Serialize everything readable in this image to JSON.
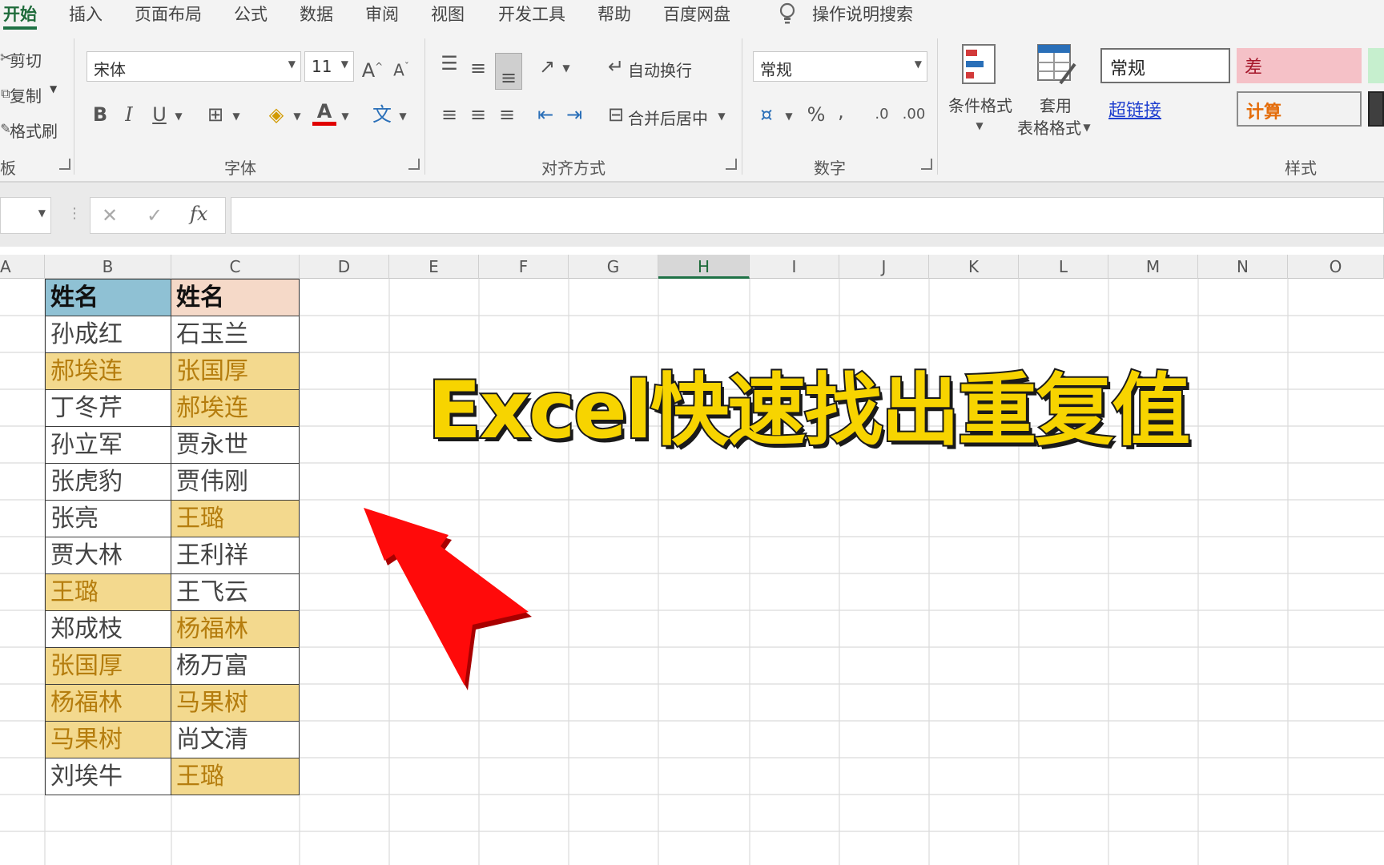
{
  "tabs": [
    {
      "label": "开始",
      "active": true
    },
    {
      "label": "插入"
    },
    {
      "label": "页面布局"
    },
    {
      "label": "公式"
    },
    {
      "label": "数据"
    },
    {
      "label": "审阅"
    },
    {
      "label": "视图"
    },
    {
      "label": "开发工具"
    },
    {
      "label": "帮助"
    },
    {
      "label": "百度网盘"
    }
  ],
  "tell_me": "操作说明搜索",
  "ribbon": {
    "clipboard": {
      "cut": "剪切",
      "copy": "复制",
      "format_painter": "格式刷",
      "label": "板"
    },
    "font": {
      "name": "宋体",
      "size": "11",
      "label": "字体"
    },
    "alignment": {
      "wrap": "自动换行",
      "merge": "合并后居中",
      "label": "对齐方式"
    },
    "number": {
      "format": "常规",
      "label": "数字"
    },
    "styles": {
      "conditional": "条件格式",
      "table_l1": "套用",
      "table_l2": "表格格式",
      "normal": "常规",
      "bad": "差",
      "hyperlink": "超链接",
      "calc": "计算",
      "label": "样式"
    }
  },
  "columns": [
    "A",
    "B",
    "C",
    "D",
    "E",
    "F",
    "G",
    "H",
    "I",
    "J",
    "K",
    "L",
    "M",
    "N",
    "O"
  ],
  "selected_column": "H",
  "table": {
    "header_b": "姓名",
    "header_c": "姓名",
    "rows": [
      {
        "b": "孙成红",
        "b_dup": false,
        "c": "石玉兰",
        "c_dup": false
      },
      {
        "b": "郝埃连",
        "b_dup": true,
        "c": "张国厚",
        "c_dup": true
      },
      {
        "b": "丁冬芹",
        "b_dup": false,
        "c": "郝埃连",
        "c_dup": true
      },
      {
        "b": "孙立军",
        "b_dup": false,
        "c": "贾永世",
        "c_dup": false
      },
      {
        "b": "张虎豹",
        "b_dup": false,
        "c": "贾伟刚",
        "c_dup": false
      },
      {
        "b": "张亮",
        "b_dup": false,
        "c": "王璐",
        "c_dup": true
      },
      {
        "b": "贾大林",
        "b_dup": false,
        "c": "王利祥",
        "c_dup": false
      },
      {
        "b": "王璐",
        "b_dup": true,
        "c": "王飞云",
        "c_dup": false
      },
      {
        "b": "郑成枝",
        "b_dup": false,
        "c": "杨福林",
        "c_dup": true
      },
      {
        "b": "张国厚",
        "b_dup": true,
        "c": "杨万富",
        "c_dup": false
      },
      {
        "b": "杨福林",
        "b_dup": true,
        "c": "马果树",
        "c_dup": true
      },
      {
        "b": "马果树",
        "b_dup": true,
        "c": "尚文清",
        "c_dup": false
      },
      {
        "b": "刘埃牛",
        "b_dup": false,
        "c": "王璐",
        "c_dup": true
      }
    ]
  },
  "overlay_title": "Excel快速找出重复值",
  "colors": {
    "accent_green": "#1e7145",
    "header_b_fill": "#8fc1d4",
    "header_c_fill": "#f5d9c8",
    "duplicate_fill": "#f3d98e",
    "duplicate_text": "#b57d0e",
    "title_yellow": "#f7d400",
    "arrow_red": "#ff0a0a"
  }
}
